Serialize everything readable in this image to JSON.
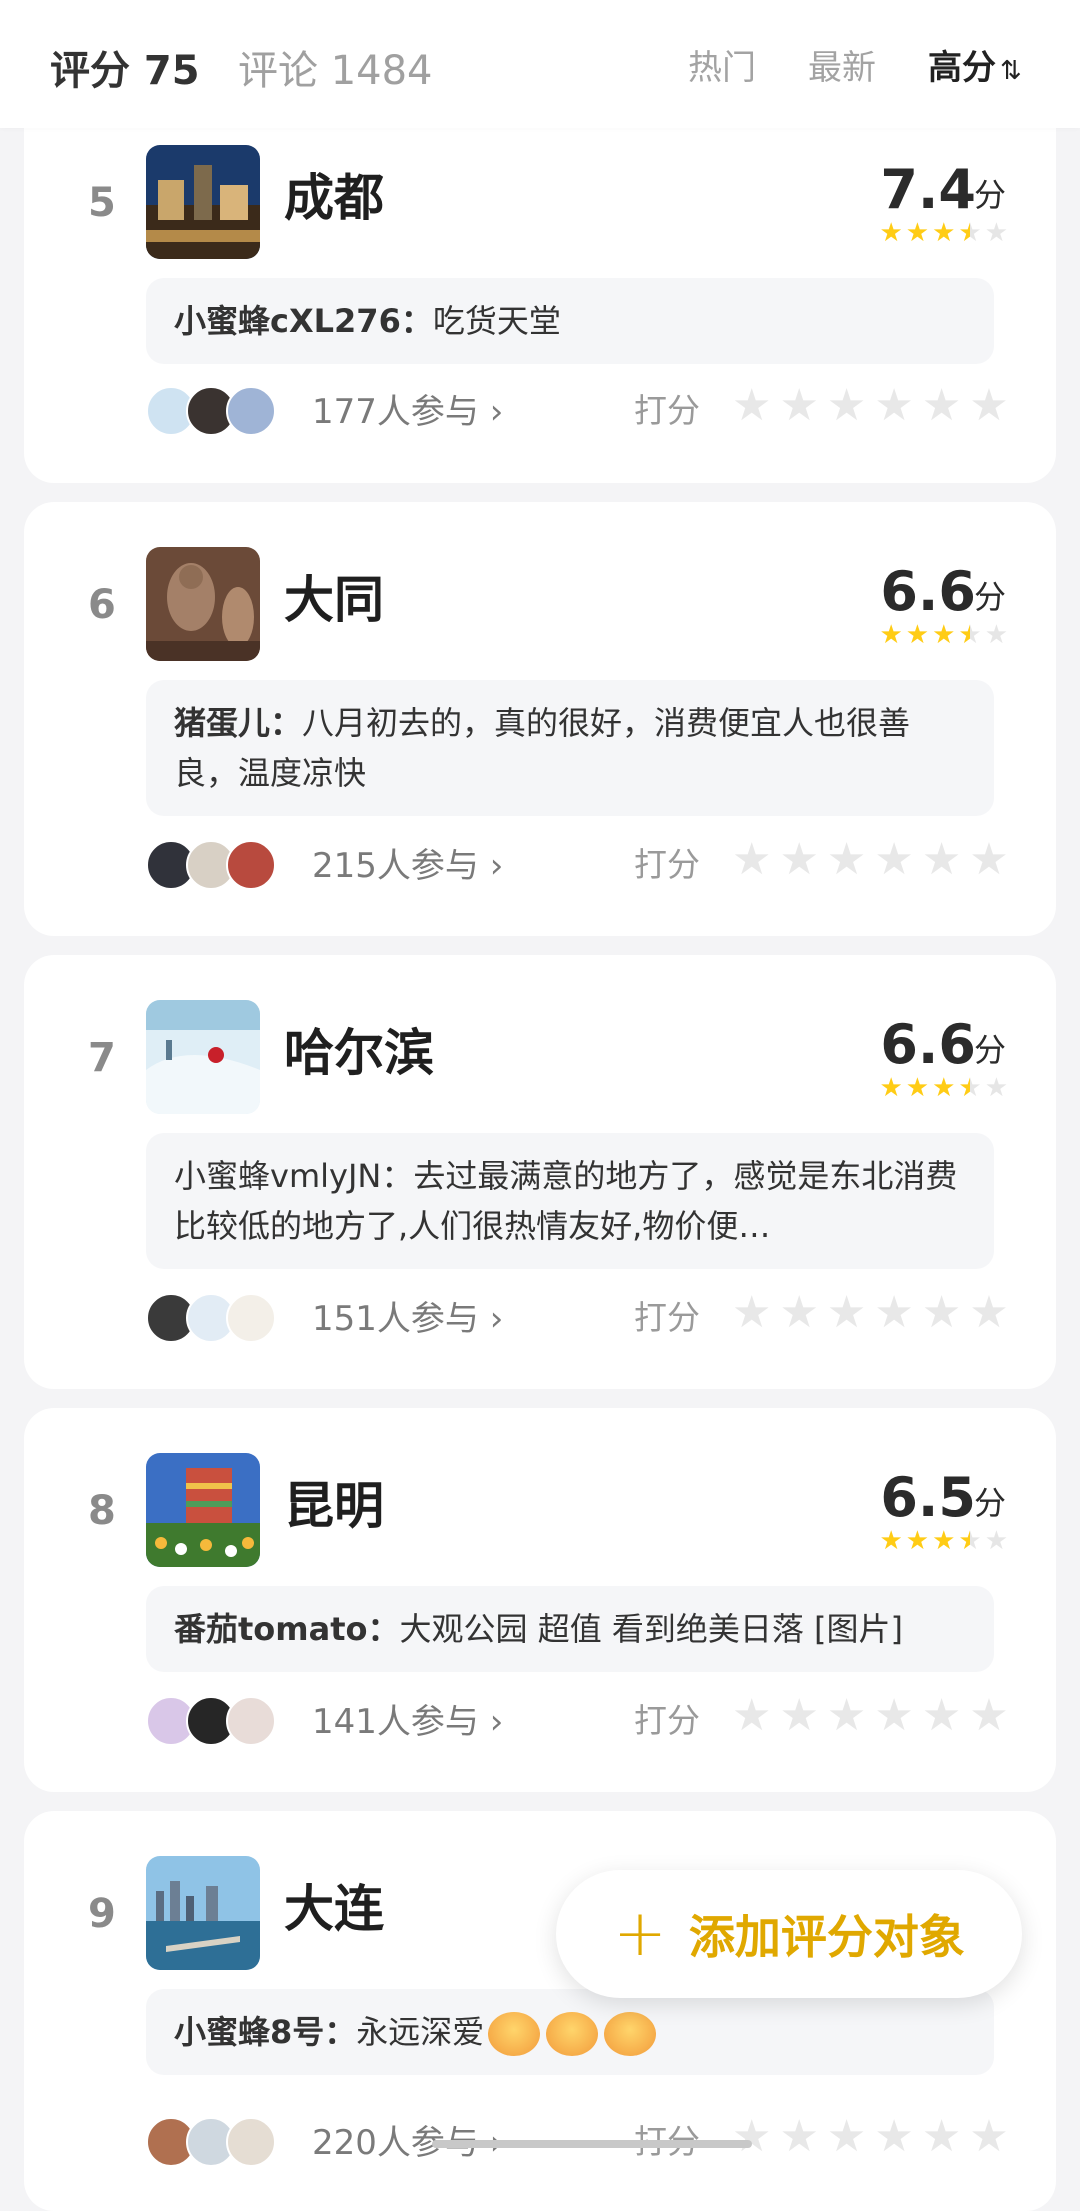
{
  "header": {
    "score_label": "评分 75",
    "comments_label": "评论 1484",
    "sort_hot": "热门",
    "sort_new": "最新",
    "sort_high": "高分",
    "sort_icon": "⇅"
  },
  "items": [
    {
      "rank": "5",
      "name": "成都",
      "score": "7.4",
      "unit": "分",
      "comment_author": "小蜜蜂cXL276：",
      "comment_text": "吃货天堂",
      "participants": "177人参与 ›",
      "rate_label": "打分",
      "stars": 3.5
    },
    {
      "rank": "6",
      "name": "大同",
      "score": "6.6",
      "unit": "分",
      "comment_author": "猪蛋儿：",
      "comment_text": "八月初去的，真的很好，消费便宜人也很善良，温度凉快",
      "participants": "215人参与 ›",
      "rate_label": "打分",
      "stars": 3.5
    },
    {
      "rank": "7",
      "name": "哈尔滨",
      "score": "6.6",
      "unit": "分",
      "comment_author": "小蜜蜂vmlyJN：",
      "comment_text": "去过最满意的地方了，感觉是东北消费比较低的地方了,人们很热情友好,物价便…",
      "participants": "151人参与 ›",
      "rate_label": "打分",
      "stars": 3.5
    },
    {
      "rank": "8",
      "name": "昆明",
      "score": "6.5",
      "unit": "分",
      "comment_author": "番茄tomato：",
      "comment_text": "大观公园 超值 看到绝美日落 [图片]",
      "participants": "141人参与 ›",
      "rate_label": "打分",
      "stars": 3.5
    },
    {
      "rank": "9",
      "name": "大连",
      "score": "",
      "unit": "",
      "comment_author": "小蜜蜂8号：",
      "comment_text": "永远深爱",
      "participants": "220人参与 ›",
      "rate_label": "打分",
      "stars": 0
    }
  ],
  "fab": {
    "plus": "+",
    "label": "添加评分对象"
  },
  "colors": {
    "accent": "#ffcc15",
    "fab_text": "#e0a800"
  }
}
